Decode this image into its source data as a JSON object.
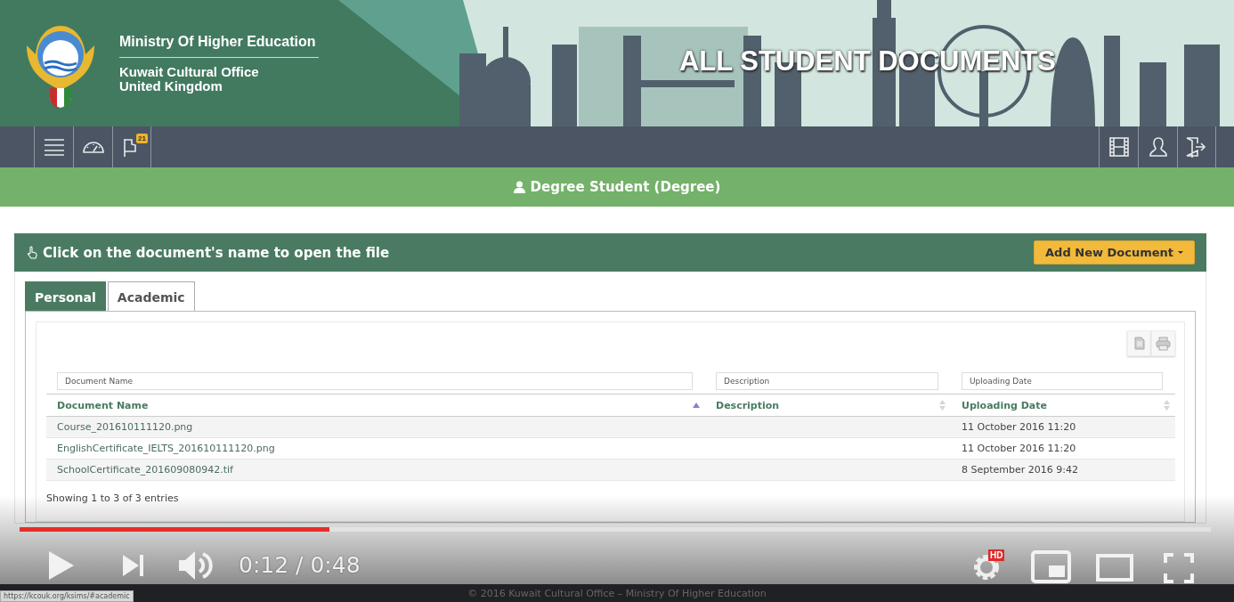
{
  "header": {
    "ministry": "Ministry Of Higher Education",
    "office": "Kuwait Cultural Office",
    "country": "United Kingdom",
    "title": "ALL STUDENT DOCUMENTS"
  },
  "navbar": {
    "left": [
      {
        "kind": "menu"
      },
      {
        "kind": "gauge"
      },
      {
        "kind": "flag",
        "badge": "21"
      }
    ],
    "right": [
      {
        "kind": "film"
      },
      {
        "kind": "user"
      },
      {
        "kind": "exit"
      }
    ]
  },
  "student_banner": "Degree Student (Degree)",
  "panel": {
    "instruction": "Click on the document's name to open the file",
    "add_button": "Add New Document"
  },
  "tabs": [
    {
      "label": "Personal",
      "selected": true
    },
    {
      "label": "Academic",
      "selected": false
    }
  ],
  "table": {
    "tools": [
      {
        "kind": "document"
      },
      {
        "kind": "print"
      }
    ],
    "filters": [
      {
        "placeholder": "Document Name"
      },
      {
        "placeholder": "Description"
      },
      {
        "placeholder": "Uploading Date"
      }
    ],
    "columns": [
      {
        "label": "Document Name",
        "sorted": true
      },
      {
        "label": "Description",
        "sorted": false
      },
      {
        "label": "Uploading Date",
        "sorted": false
      }
    ],
    "rows": [
      {
        "document_name": "Course_201610111120.png",
        "uploading_date": "11 October 2016 11:20"
      },
      {
        "document_name": "EnglishCertificate_IELTS_201610111120.png",
        "uploading_date": "11 October 2016 11:20"
      },
      {
        "document_name": "SchoolCertificate_201609080942.tif",
        "uploading_date": "8 September 2016 9:42"
      }
    ],
    "info": "Showing 1 to 3 of 3 entries"
  },
  "footer": "© 2016 Kuwait Cultural Office – Ministry Of Higher Education",
  "status_url": "https://kcouk.org/ksims/#academic",
  "player": {
    "level": 0.26,
    "time": "0:12 / 0:48",
    "quality_badge": "HD"
  }
}
